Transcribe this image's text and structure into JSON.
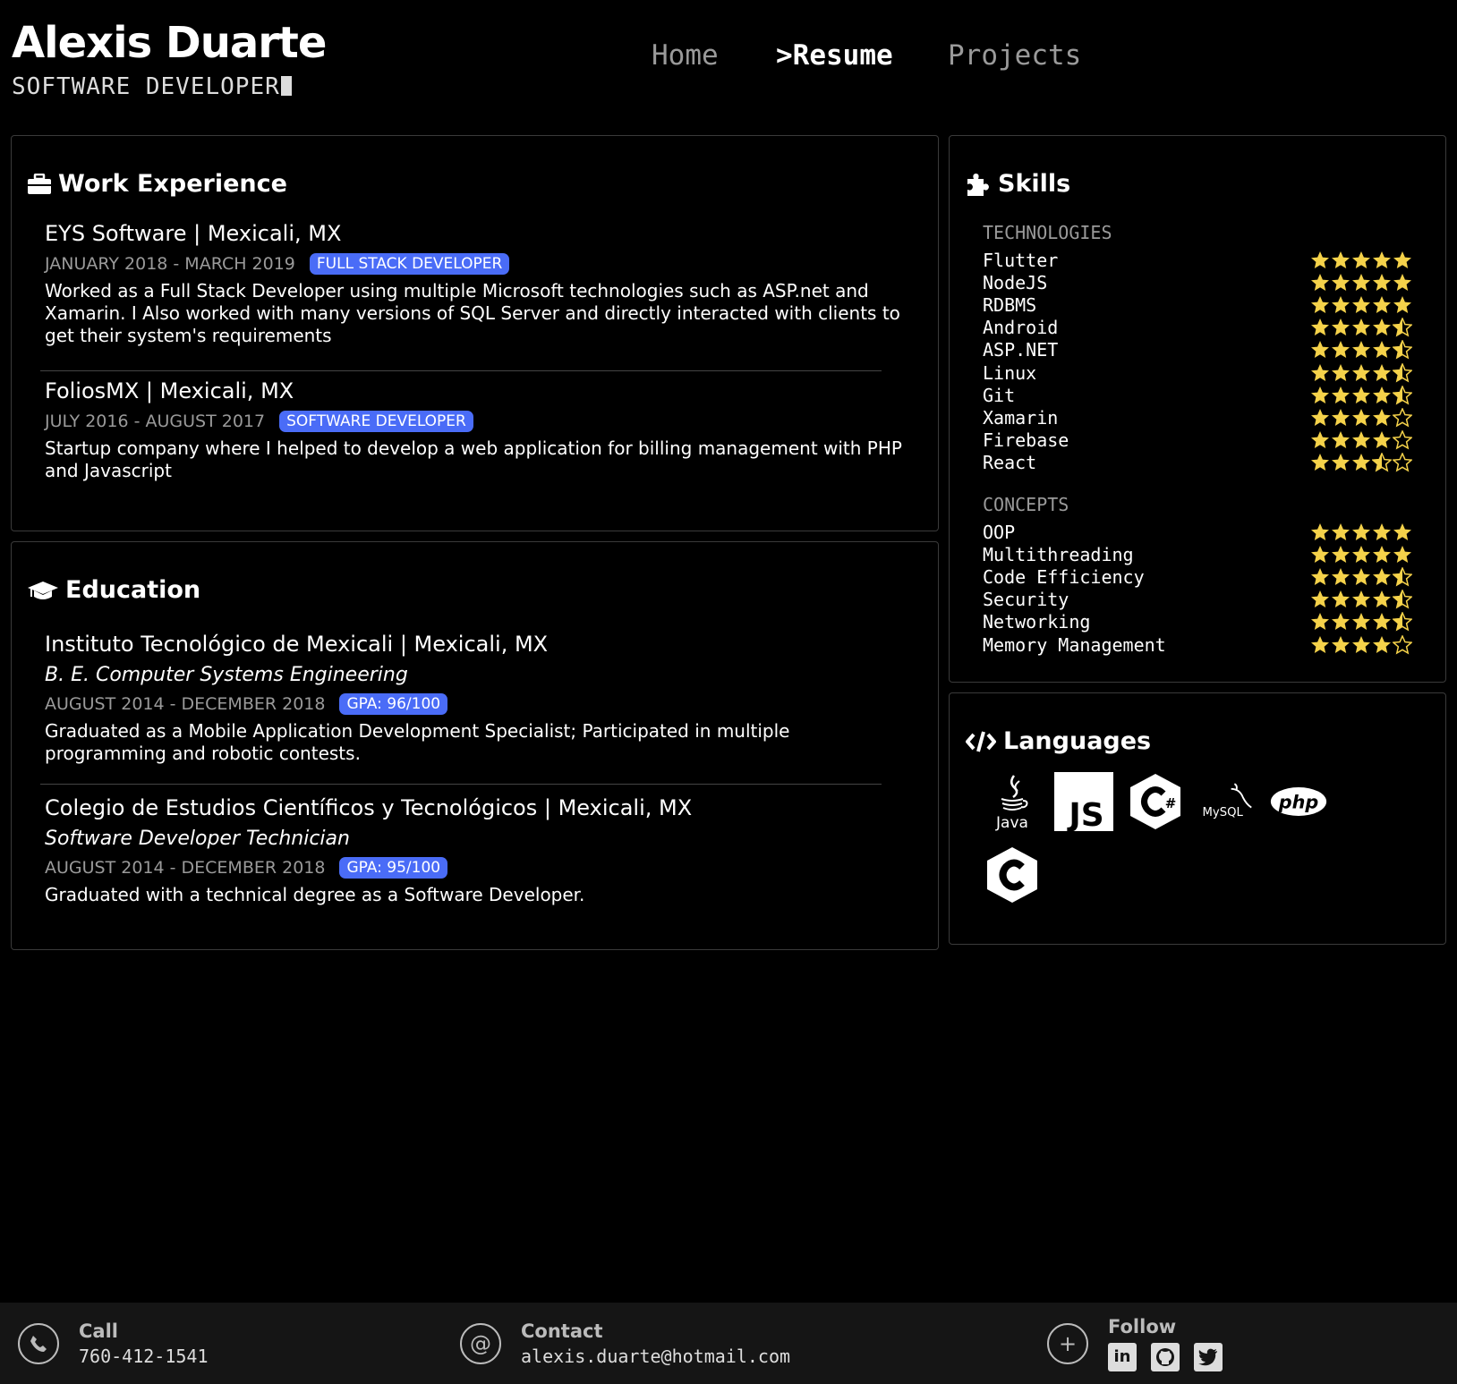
{
  "header": {
    "name": "Alexis Duarte",
    "role": "SOFTWARE DEVELOPER",
    "nav": {
      "home": "Home",
      "resume": ">Resume",
      "projects": "Projects"
    }
  },
  "work": {
    "title": "Work Experience",
    "entries": [
      {
        "title": "EYS Software | Mexicali, MX",
        "date": "JANUARY 2018 - MARCH 2019",
        "badge": "FULL STACK DEVELOPER",
        "desc": "Worked as a Full Stack Developer using multiple Microsoft technologies such as ASP.net and Xamarin. I Also worked with many versions of SQL Server and directly interacted with clients to get their system's requirements"
      },
      {
        "title": "FoliosMX | Mexicali, MX",
        "date": "JULY 2016 - AUGUST 2017",
        "badge": "SOFTWARE DEVELOPER",
        "desc": "Startup company where I helped to develop a web application for billing management with PHP and Javascript"
      }
    ]
  },
  "education": {
    "title": "Education",
    "entries": [
      {
        "title": "Instituto Tecnológico de Mexicali | Mexicali, MX",
        "degree": "B. E. Computer Systems Engineering",
        "date": "AUGUST 2014 - DECEMBER 2018",
        "badge": "GPA: 96/100",
        "desc": "Graduated as a Mobile Application Development Specialist; Participated in multiple programming and robotic contests."
      },
      {
        "title": "Colegio de Estudios Científicos y Tecnológicos | Mexicali, MX",
        "degree": "Software Developer Technician",
        "date": "AUGUST 2014 - DECEMBER 2018",
        "badge": "GPA: 95/100",
        "desc": "Graduated with a technical degree as a Software Developer."
      }
    ]
  },
  "skills": {
    "title": "Skills",
    "star_color": "#f5d24a",
    "technologies_label": "TECHNOLOGIES",
    "technologies": [
      {
        "name": "Flutter",
        "rating": 5
      },
      {
        "name": "NodeJS",
        "rating": 5
      },
      {
        "name": "RDBMS",
        "rating": 5
      },
      {
        "name": "Android",
        "rating": 4.5
      },
      {
        "name": "ASP.NET",
        "rating": 4.5
      },
      {
        "name": "Linux",
        "rating": 4.5
      },
      {
        "name": "Git",
        "rating": 4.5
      },
      {
        "name": "Xamarin",
        "rating": 4
      },
      {
        "name": "Firebase",
        "rating": 4
      },
      {
        "name": "React",
        "rating": 3.5
      }
    ],
    "concepts_label": "CONCEPTS",
    "concepts": [
      {
        "name": "OOP",
        "rating": 5
      },
      {
        "name": "Multithreading",
        "rating": 5
      },
      {
        "name": "Code Efficiency",
        "rating": 4.5
      },
      {
        "name": "Security",
        "rating": 4.5
      },
      {
        "name": "Networking",
        "rating": 4.5
      },
      {
        "name": "Memory Management",
        "rating": 4
      }
    ]
  },
  "languages": {
    "title": "Languages",
    "items": [
      {
        "icon": "java-icon",
        "label": "Java"
      },
      {
        "icon": "javascript-icon",
        "label": "JS"
      },
      {
        "icon": "csharp-icon",
        "label": "C#"
      },
      {
        "icon": "mysql-icon",
        "label": "MySQL"
      },
      {
        "icon": "php-icon",
        "label": "php"
      },
      {
        "icon": "c-icon",
        "label": "C"
      }
    ]
  },
  "footer": {
    "call_label": "Call",
    "call_value": "760-412-1541",
    "contact_label": "Contact",
    "contact_value": "alexis.duarte@hotmail.com",
    "follow_label": "Follow",
    "social": [
      "linkedin-icon",
      "github-icon",
      "twitter-icon"
    ]
  }
}
